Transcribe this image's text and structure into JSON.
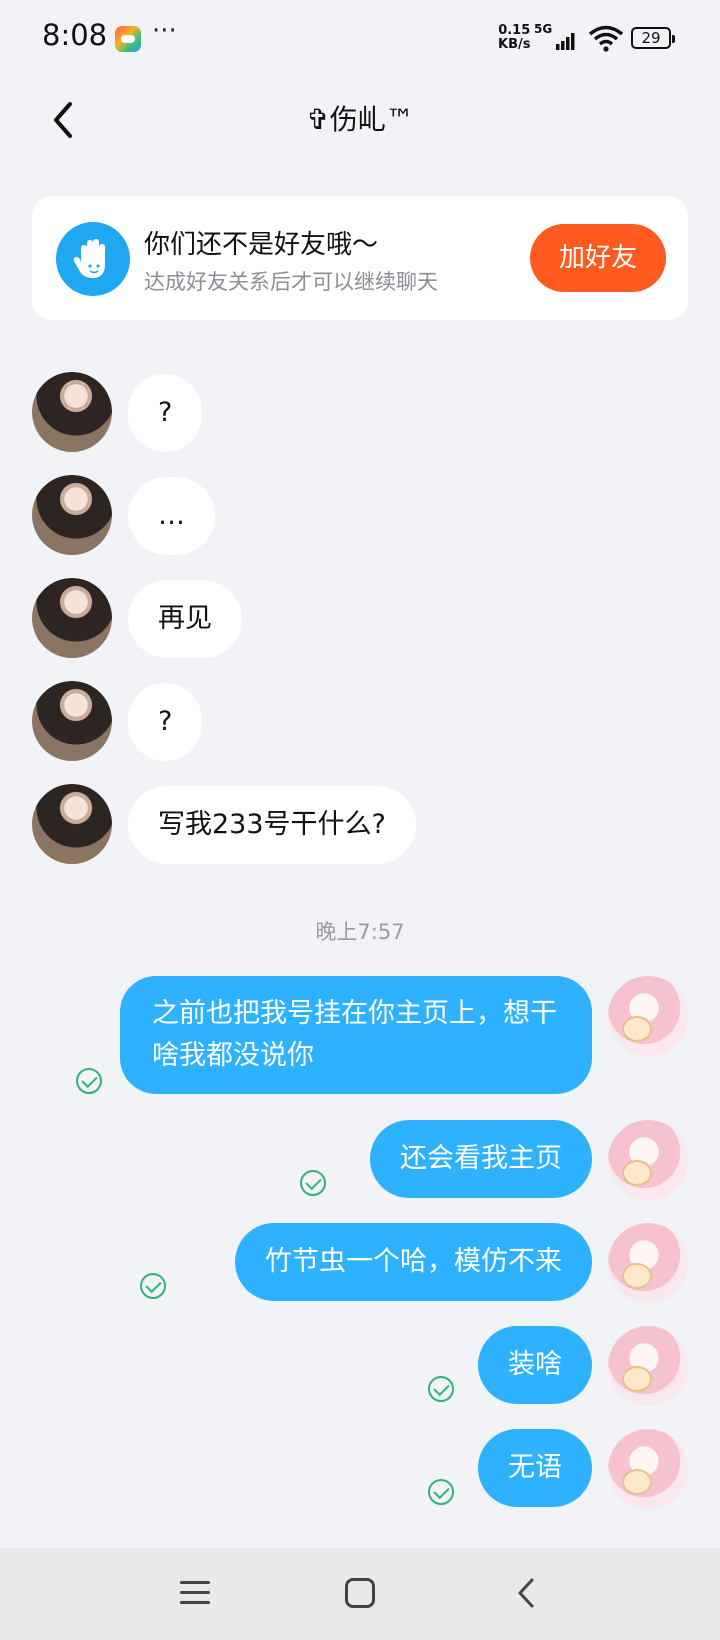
{
  "status_bar": {
    "time": "8:08",
    "app_icon": "game-center-icon",
    "overflow": "···",
    "net_speed_value": "0.15",
    "net_speed_unit": "KB/s",
    "signal_label": "5G",
    "battery": "29"
  },
  "header": {
    "title": "✞伤乢™",
    "back_icon": "chevron-left-icon"
  },
  "friend_notice": {
    "icon": "waving-hand-icon",
    "title": "你们还不是好友哦～",
    "subtitle": "达成好友关系后才可以继续聊天",
    "add_button": "加好友",
    "accent_color": "#ff5a1f"
  },
  "messages_in": [
    {
      "text": "?"
    },
    {
      "text": "…"
    },
    {
      "text": "再见"
    },
    {
      "text": "?"
    },
    {
      "text": "写我233号干什么?"
    }
  ],
  "timestamp": "晚上7:57",
  "messages_out": [
    {
      "text": "之前也把我号挂在你主页上，想干啥我都没说你",
      "status": "read"
    },
    {
      "text": "还会看我主页",
      "status": "read"
    },
    {
      "text": "竹节虫一个哈，模仿不来",
      "status": "read"
    },
    {
      "text": "装啥",
      "status": "read"
    },
    {
      "text": "无语",
      "status": "read"
    }
  ],
  "colors": {
    "out_bubble": "#2eb2ff",
    "in_bubble": "#ffffff",
    "read_check": "#2fb37b",
    "background": "#f2f3f7"
  },
  "nav_bar": {
    "icons": [
      "menu-icon",
      "home-icon",
      "back-icon"
    ]
  }
}
